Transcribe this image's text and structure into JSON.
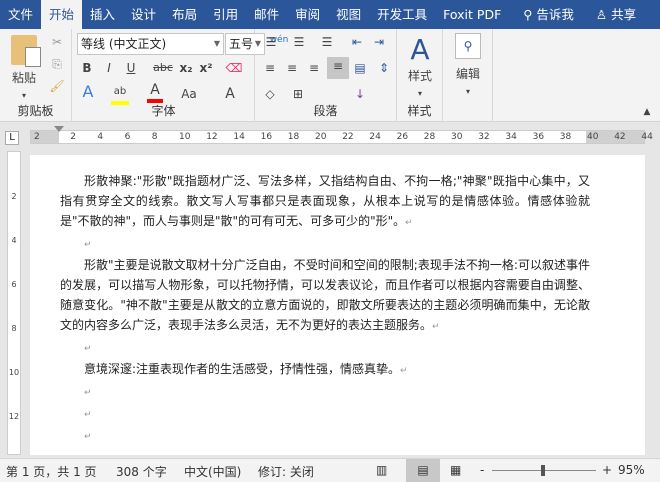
{
  "tabs": [
    "文件",
    "开始",
    "插入",
    "设计",
    "布局",
    "引用",
    "邮件",
    "审阅",
    "视图",
    "开发工具",
    "Foxit PDF"
  ],
  "tell_me": "告诉我",
  "share": "共享",
  "ribbon": {
    "clipboard": {
      "paste": "粘贴",
      "label": "剪贴板"
    },
    "font": {
      "name": "等线 (中文正文)",
      "size": "五号",
      "pinyin": "wén",
      "bold": "B",
      "italic": "I",
      "underline": "U",
      "strike": "abc",
      "sub": "x₂",
      "sup": "x²",
      "case": "Aa",
      "label": "字体",
      "highlight_color": "#ffff00",
      "font_color": "#ff0000",
      "enclose": "字"
    },
    "paragraph": {
      "label": "段落"
    },
    "styles": {
      "button": "样式",
      "label": "样式"
    },
    "editing": {
      "button": "编辑"
    }
  },
  "ruler": {
    "h": [
      "2",
      "2",
      "4",
      "6",
      "8",
      "10",
      "12",
      "14",
      "16",
      "18",
      "20",
      "22",
      "24",
      "26",
      "28",
      "30",
      "32",
      "34",
      "36",
      "38",
      "40",
      "42",
      "44"
    ],
    "v": [
      "2",
      "4",
      "6",
      "8",
      "10",
      "12"
    ]
  },
  "document": {
    "paragraphs": [
      "形散神聚:\"形散\"既指题材广泛、写法多样，又指结构自由、不拘一格;\"神聚\"既指中心集中，又指有贯穿全文的线索。散文写人写事都只是表面现象，从根本上说写的是情感体验。情感体验就是\"不散的神\"，而人与事则是\"散\"的可有可无、可多可少的\"形\"。",
      "",
      "形散\"主要是说散文取材十分广泛自由，不受时间和空间的限制;表现手法不拘一格:可以叙述事件的发展，可以描写人物形象，可以托物抒情，可以发表议论，而且作者可以根据内容需要自由调整、随意变化。\"神不散\"主要是从散文的立意方面说的，即散文所要表达的主题必须明确而集中，无论散文的内容多么广泛，表现手法多么灵活，无不为更好的表达主题服务。",
      "",
      "意境深邃:注重表现作者的生活感受，抒情性强，情感真挚。",
      "",
      "",
      ""
    ],
    "paragraph_mark": "↵"
  },
  "status": {
    "page": "第 1 页，共 1 页",
    "words": "308 个字",
    "language": "中文(中国)",
    "track": "修订: 关闭",
    "zoom": "95%",
    "zoom_value": 95
  }
}
